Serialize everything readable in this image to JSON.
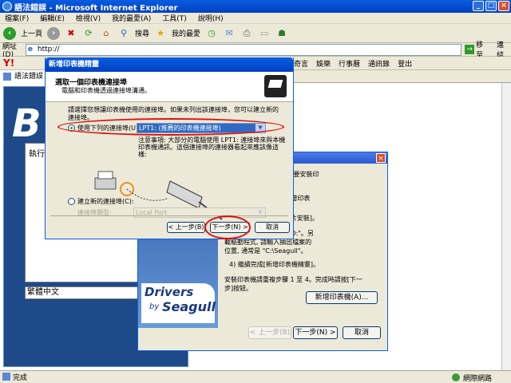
{
  "browser": {
    "title": "語法錯誤 - Microsoft Internet Explorer",
    "menu": [
      "檔案(F)",
      "編輯(E)",
      "檢視(V)",
      "我的最愛(A)",
      "工具(T)",
      "說明(H)"
    ],
    "toolbar": {
      "back": "上一頁",
      "search": "搜尋",
      "favorites": "我的最愛"
    },
    "address_label": "網址(D)",
    "address_value": "http://",
    "go_label": "移至",
    "links_label": "連結",
    "yahoo_logo": "Y!",
    "yahoo_items": [
      "奇言",
      "娛樂",
      "行事曆",
      "通訊錄",
      "登出"
    ],
    "tab_title": "語法錯誤",
    "status_left": "完成",
    "status_right": "網際網路"
  },
  "background_app": {
    "logo_letter": "B",
    "run_label": "執行",
    "language": "繁體中文"
  },
  "seagull_wizard": {
    "brand_drivers": "Drivers",
    "brand_by": "by",
    "brand_seagull": "Seagull",
    "text_lines": [
      "安裝], 請按[下一步]。若要安裝印",
      "步驟進行。",
      "",
      "鈕]按鈕, 將開始執行[新增印表",
      "",
      "驅動程式時, 請按 [從磁片安裝]。",
      "",
      "光碟機的目錄, 通常是 \"D:\"。另",
      "載驅動程式, 請輸入抽出檔案的",
      "位置, 通常是 \"C:\\Seagull\"。",
      "",
      "4) 繼續完成[新增印表機精靈]。",
      "",
      "安裝印表機請重複步驟 1 至 4。完成時請按[下一",
      "步]按鈕。"
    ],
    "add_printer_button": "新增印表機(A)...",
    "back_button": "< 上一步(B)",
    "next_button": "下一步(N) >",
    "cancel_button": "取消"
  },
  "dialog": {
    "title": "新增印表機精靈",
    "heading": "選取一個印表機連接埠",
    "subheading": "電腦和印表機透過連接埠溝通。",
    "description": "請選擇您想讓印表機使用的連接埠。如果未列出該連接埠，您可以建立新的連接埠。",
    "option_use_existing": "使用下列的連接埠(U):",
    "existing_port_value": "LPT1: (推薦的印表機連接埠)",
    "note": "注意事項: 大部分的電腦使用 LPT1: 連接埠來與本機印表機通訊。這個連接埠的連接器看起來應該像這樣:",
    "option_create_new": "建立新的連接埠(C):",
    "port_type_label": "連接埠類型:",
    "port_type_value": "Local Port",
    "back_button": "< 上一步(B)",
    "next_button": "下一步(N) >",
    "cancel_button": "取消"
  },
  "colors": {
    "titlebar": "#0a5de0",
    "highlight_oval": "#e01010",
    "selected_port": "#316ac5"
  }
}
